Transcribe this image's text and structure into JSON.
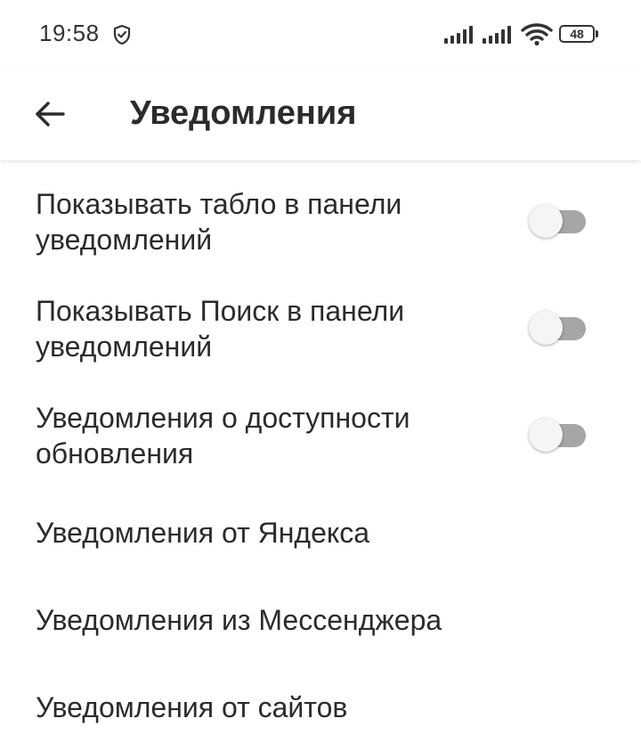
{
  "status_bar": {
    "time": "19:58",
    "battery": "48"
  },
  "header": {
    "title": "Уведомления"
  },
  "settings": {
    "items": [
      {
        "line1": "Показывать табло в панели",
        "line2": "уведомлений",
        "toggle": false
      },
      {
        "line1": "Показывать Поиск в панели",
        "line2": "уведомлений",
        "toggle": false
      },
      {
        "line1": "Уведомления о доступности",
        "line2": "обновления",
        "toggle": false
      },
      {
        "label": "Уведомления от Яндекса"
      },
      {
        "label": "Уведомления из Мессенджера"
      },
      {
        "label": "Уведомления от сайтов"
      }
    ]
  },
  "colors": {
    "toggle_track_off": "#a6a6a6",
    "toggle_thumb_off": "#f5f5f5",
    "text": "#2b2b2b"
  },
  "icons": {
    "back": "arrow-left-icon",
    "status": [
      "shield-icon",
      "signal-icon",
      "signal-icon",
      "wifi-icon",
      "battery-icon"
    ]
  }
}
